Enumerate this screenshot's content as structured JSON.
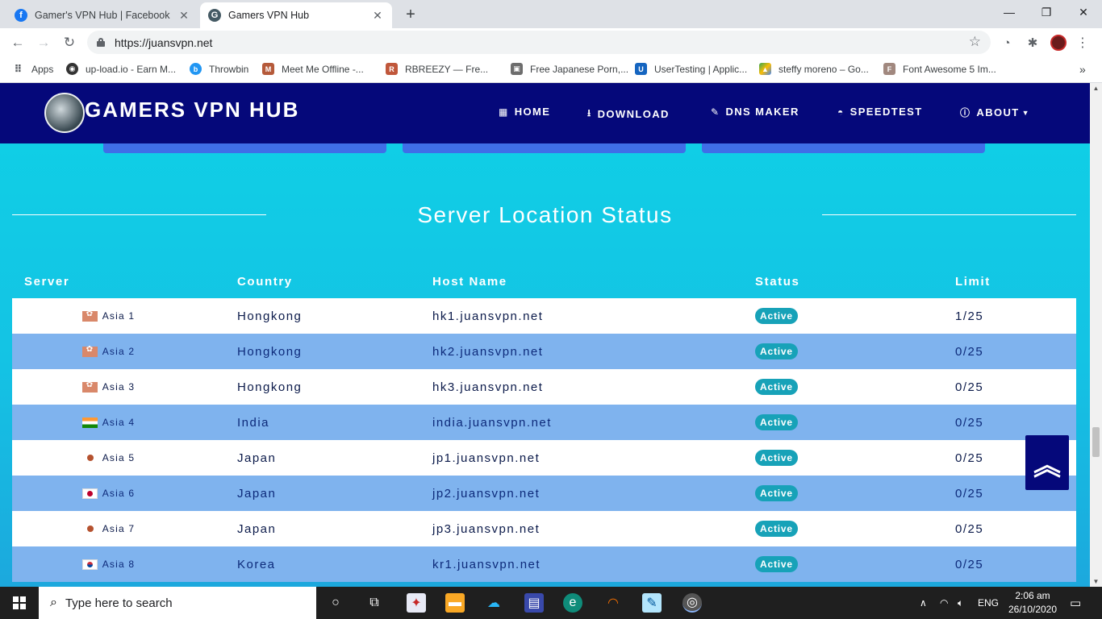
{
  "browser": {
    "tabs": [
      {
        "title": "Gamer's VPN Hub | Facebook",
        "active": false
      },
      {
        "title": "Gamers VPN Hub",
        "active": true
      }
    ],
    "url": "https://juansvpn.net",
    "bookmarks": [
      {
        "label": "Apps",
        "icon": "apps-grid-icon"
      },
      {
        "label": "up-load.io - Earn M...",
        "icon": "upload-site-icon"
      },
      {
        "label": "Throwbin",
        "icon": "throwbin-icon"
      },
      {
        "label": "Meet Me Offline -...",
        "icon": "meetme-icon"
      },
      {
        "label": "RBREEZY — Fre...",
        "icon": "rbreezy-icon"
      },
      {
        "label": "Free Japanese Porn,...",
        "icon": "site-icon"
      },
      {
        "label": "UserTesting | Applic...",
        "icon": "usertesting-icon"
      },
      {
        "label": "steffy moreno – Go...",
        "icon": "google-drive-icon"
      },
      {
        "label": "Font Awesome 5 Im...",
        "icon": "fontawesome-icon"
      }
    ],
    "bookmarks_more": "»"
  },
  "site": {
    "logo_text": "GAMERS VPN HUB",
    "nav": [
      {
        "label": "HOME",
        "icon": "th-large-icon"
      },
      {
        "label": "DOWNLOAD",
        "icon": "download-icon"
      },
      {
        "label": "DNS MAKER",
        "icon": "edit-icon"
      },
      {
        "label": "SPEEDTEST",
        "icon": "tachometer-icon"
      },
      {
        "label": "ABOUT",
        "icon": "info-circle-icon",
        "dropdown": true
      }
    ],
    "section_title": "Server Location Status",
    "table": {
      "headers": [
        "Server",
        "Country",
        "Host Name",
        "Status",
        "Limit"
      ],
      "rows": [
        {
          "server": "Asia 1",
          "flag": "hk",
          "country": "Hongkong",
          "host": "hk1.juansvpn.net",
          "status": "Active",
          "limit": "1/25"
        },
        {
          "server": "Asia 2",
          "flag": "hk",
          "country": "Hongkong",
          "host": "hk2.juansvpn.net",
          "status": "Active",
          "limit": "0/25"
        },
        {
          "server": "Asia 3",
          "flag": "hk",
          "country": "Hongkong",
          "host": "hk3.juansvpn.net",
          "status": "Active",
          "limit": "0/25"
        },
        {
          "server": "Asia 4",
          "flag": "in",
          "country": "India",
          "host": "india.juansvpn.net",
          "status": "Active",
          "limit": "0/25"
        },
        {
          "server": "Asia 5",
          "flag": "jpdot",
          "country": "Japan",
          "host": "jp1.juansvpn.net",
          "status": "Active",
          "limit": "0/25"
        },
        {
          "server": "Asia 6",
          "flag": "jp",
          "country": "Japan",
          "host": "jp2.juansvpn.net",
          "status": "Active",
          "limit": "0/25"
        },
        {
          "server": "Asia 7",
          "flag": "jpdot",
          "country": "Japan",
          "host": "jp3.juansvpn.net",
          "status": "Active",
          "limit": "0/25"
        },
        {
          "server": "Asia 8",
          "flag": "kr",
          "country": "Korea",
          "host": "kr1.juansvpn.net",
          "status": "Active",
          "limit": "0/25"
        }
      ]
    },
    "colors": {
      "navbar": "#05087a",
      "badge": "#17a2b8",
      "row_alt": "#7fb3ee"
    }
  },
  "taskbar": {
    "search_placeholder": "Type here to search",
    "language": "ENG",
    "time": "2:06 am",
    "date": "26/10/2020"
  }
}
